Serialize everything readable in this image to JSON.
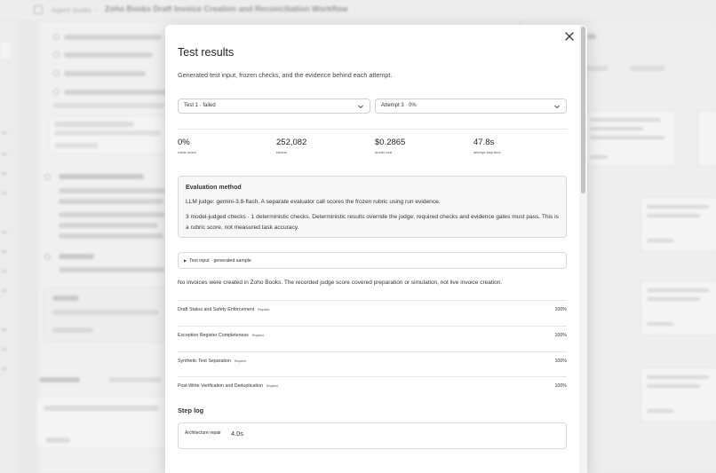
{
  "background": {
    "breadcrumb": "Agent studio",
    "title": "Zoho Books Draft Invoice Creation and Reconciliation Workflow"
  },
  "modal": {
    "title": "Test results",
    "subtitle": "Generated test input, frozen checks, and the evidence behind each attempt.",
    "test_select": "Test 1 · failed",
    "attempt_select": "Attempt 3 · 0%",
    "stats": [
      {
        "value": "0%",
        "label": "rubric score"
      },
      {
        "value": "252,082",
        "label": "tokens"
      },
      {
        "value": "$0.2865",
        "label": "model cost"
      },
      {
        "value": "47.8s",
        "label": "attempt step time"
      }
    ],
    "evaluation": {
      "heading": "Evaluation method",
      "line1": "LLM judge: gemini-3.8-flash. A separate evaluator call scores the frozen rubric using run evidence.",
      "line2": "3 model-judged checks · 1 deterministic checks. Deterministic results override the judge; required checks and evidence gates must pass. This is a rubric score, not measured task accuracy."
    },
    "test_input_toggle": "Test input · generated sample",
    "note": "No invoices were created in Zoho Books. The recorded judge score covered preparation or simulation, not live invoice creation.",
    "criteria": [
      {
        "name": "Draft Status and Safety Enforcement",
        "badge": "Required",
        "pct": "100%"
      },
      {
        "name": "Exception Register Completeness",
        "badge": "Required",
        "pct": "100%"
      },
      {
        "name": "Synthetic Test Separation",
        "badge": "Required",
        "pct": "100%"
      },
      {
        "name": "Post-Write Verification and Deduplication",
        "badge": "Required",
        "pct": "100%"
      }
    ],
    "step_log": {
      "heading": "Step log",
      "step_name": "Architecture repair",
      "duration": "4.0s"
    }
  }
}
